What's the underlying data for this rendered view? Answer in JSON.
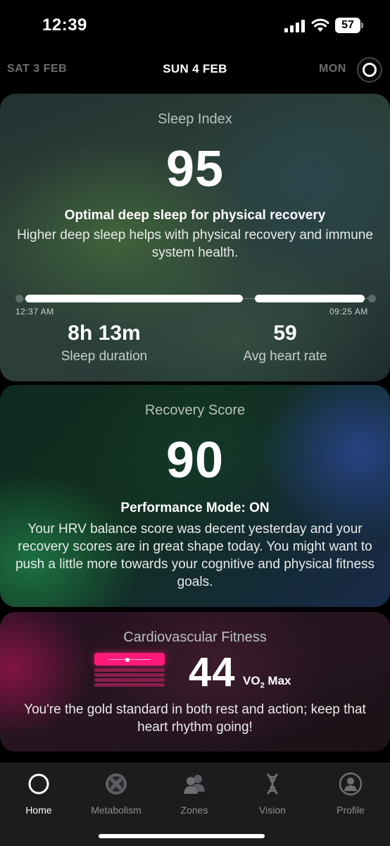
{
  "status_bar": {
    "time": "12:39",
    "battery": "57"
  },
  "date_nav": {
    "prev": "SAT 3 FEB",
    "current": "SUN 4 FEB",
    "next": "MON"
  },
  "sleep": {
    "title": "Sleep Index",
    "score": "95",
    "headline": "Optimal deep sleep for physical recovery",
    "body": "Higher deep sleep helps with physical recovery and immune system health.",
    "start_time": "12:37 AM",
    "end_time": "09:25 AM",
    "duration_value": "8h 13m",
    "duration_label": "Sleep duration",
    "hr_value": "59",
    "hr_label": "Avg heart rate"
  },
  "recovery": {
    "title": "Recovery Score",
    "score": "90",
    "headline": "Performance Mode: ON",
    "body": "Your HRV balance score was decent yesterday and your recovery scores are in great shape today. You might want to push a little more towards your cognitive and physical fitness goals."
  },
  "cardio": {
    "title": "Cardiovascular Fitness",
    "value": "44",
    "unit_prefix": "VO",
    "unit_sub": "2",
    "unit_suffix": " Max",
    "body": "You're the gold standard in both rest and action; keep that heart rhythm going!"
  },
  "tabs": [
    {
      "label": "Home",
      "icon": "home-ring-icon",
      "active": true
    },
    {
      "label": "Metabolism",
      "icon": "metabolism-icon",
      "active": false
    },
    {
      "label": "Zones",
      "icon": "zones-people-icon",
      "active": false
    },
    {
      "label": "Vision",
      "icon": "vision-dna-icon",
      "active": false
    },
    {
      "label": "Profile",
      "icon": "profile-icon",
      "active": false
    }
  ],
  "colors": {
    "accent_pink": "#ff1a7a",
    "tab_inactive": "#8e8e93",
    "background": "#000000"
  }
}
